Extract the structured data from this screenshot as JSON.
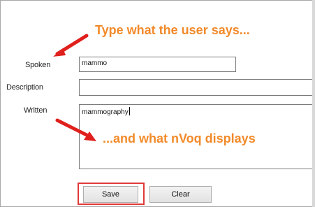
{
  "form": {
    "spoken_label": "Spoken",
    "spoken_value": "mammo",
    "description_label": "Description",
    "description_value": "",
    "written_label": "Written",
    "written_value": "mammography"
  },
  "buttons": {
    "save_label": "Save",
    "clear_label": "Clear"
  },
  "annotations": {
    "top_text": "Type what the user says...",
    "bottom_text": "...and what nVoq displays",
    "text_color": "#f28a2a",
    "arrow_color": "#e0201c",
    "highlight_color": "#e03a3a"
  }
}
